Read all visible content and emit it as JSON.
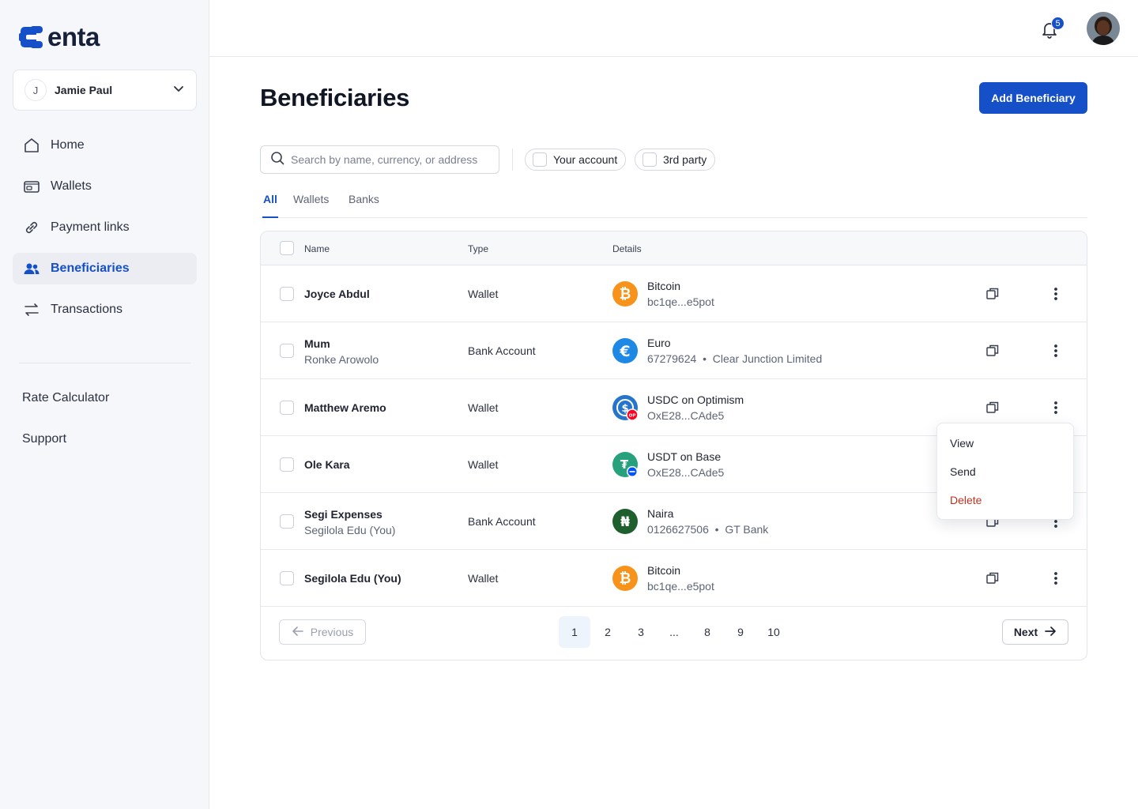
{
  "brand": {
    "name": "enta",
    "primary": "#1650c8"
  },
  "account": {
    "initial": "J",
    "name": "Jamie Paul"
  },
  "nav": [
    {
      "label": "Home",
      "icon": "home-icon"
    },
    {
      "label": "Wallets",
      "icon": "wallet-icon"
    },
    {
      "label": "Payment links",
      "icon": "link-icon"
    },
    {
      "label": "Beneficiaries",
      "icon": "users-icon",
      "active": true
    },
    {
      "label": "Transactions",
      "icon": "arrows-icon"
    }
  ],
  "secondary_links": [
    "Rate Calculator",
    "Support"
  ],
  "topbar": {
    "notification_count": "5"
  },
  "page": {
    "title": "Beneficiaries",
    "add_label": "Add Beneficiary"
  },
  "search": {
    "placeholder": "Search by name, currency, or address"
  },
  "filters": [
    "Your account",
    "3rd party"
  ],
  "tabs": [
    "All",
    "Wallets",
    "Banks"
  ],
  "table": {
    "headers": [
      "Name",
      "Type",
      "Details"
    ],
    "rows": [
      {
        "name": "Joyce Abdul",
        "sub": "",
        "type": "Wallet",
        "asset": "Bitcoin",
        "detail": "bc1qe...e5pot",
        "icon": "bitcoin-icon"
      },
      {
        "name": "Mum",
        "sub": "Ronke Arowolo",
        "type": "Bank Account",
        "asset": "Euro",
        "detail": "67279624  •  Clear Junction Limited",
        "icon": "euro-icon"
      },
      {
        "name": "Matthew Aremo",
        "sub": "",
        "type": "Wallet",
        "asset": "USDC on Optimism",
        "detail": "OxE28...CAde5",
        "icon": "usdc-icon"
      },
      {
        "name": "Ole Kara",
        "sub": "",
        "type": "Wallet",
        "asset": "USDT on Base",
        "detail": "OxE28...CAde5",
        "icon": "usdt-icon"
      },
      {
        "name": "Segi Expenses",
        "sub": "Segilola Edu (You)",
        "type": "Bank Account",
        "asset": "Naira",
        "detail": "0126627506  •  GT Bank",
        "icon": "naira-icon"
      },
      {
        "name": "Segilola Edu (You)",
        "sub": "",
        "type": "Wallet",
        "asset": "Bitcoin",
        "detail": "bc1qe...e5pot",
        "icon": "bitcoin-icon"
      }
    ]
  },
  "pagination": {
    "prev": "Previous",
    "next": "Next",
    "pages": [
      "1",
      "2",
      "3",
      "...",
      "8",
      "9",
      "10"
    ],
    "current": "1"
  },
  "row_menu": [
    "View",
    "Send",
    "Delete"
  ]
}
